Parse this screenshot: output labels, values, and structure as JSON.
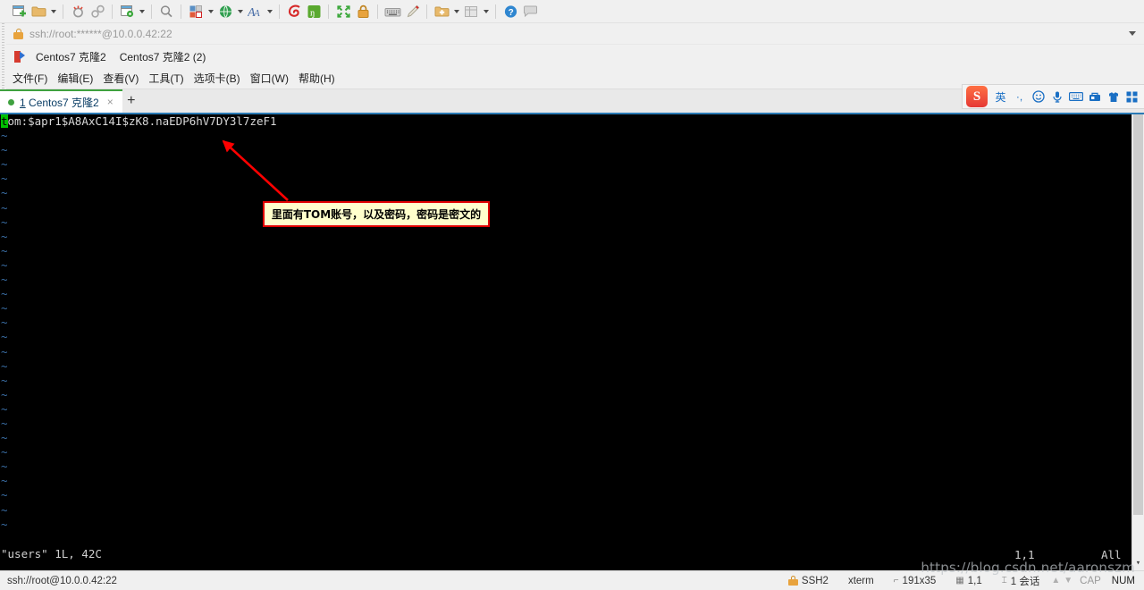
{
  "toolbar": {
    "groups": [
      [
        {
          "name": "new-session-icon",
          "glyph": "new-file"
        },
        {
          "name": "open-folder-icon",
          "glyph": "folder",
          "caret": true
        }
      ],
      [
        {
          "name": "disconnect-icon",
          "glyph": "disconnect"
        },
        {
          "name": "connect-icon",
          "glyph": "link"
        }
      ],
      [
        {
          "name": "session-properties-icon",
          "glyph": "props",
          "caret": true
        }
      ],
      [
        {
          "name": "find-icon",
          "glyph": "search"
        }
      ],
      [
        {
          "name": "layout-icon",
          "glyph": "layout",
          "caret": true
        },
        {
          "name": "global-options-icon",
          "glyph": "globe",
          "caret": true
        },
        {
          "name": "font-icon",
          "glyph": "font",
          "caret": true
        }
      ],
      [
        {
          "name": "log-icon",
          "glyph": "spiral"
        },
        {
          "name": "transfer-icon",
          "glyph": "green-box"
        }
      ],
      [
        {
          "name": "fullscreen-icon",
          "glyph": "expand"
        },
        {
          "name": "lock-icon",
          "glyph": "padlock"
        }
      ],
      [
        {
          "name": "keyboard-icon",
          "glyph": "keyboard"
        },
        {
          "name": "highlight-icon",
          "glyph": "pen"
        }
      ],
      [
        {
          "name": "new-tab-icon",
          "glyph": "add-folder",
          "caret": true
        },
        {
          "name": "split-view-icon",
          "glyph": "split",
          "caret": true
        }
      ],
      [
        {
          "name": "help-icon",
          "glyph": "help"
        },
        {
          "name": "chat-icon",
          "glyph": "chat"
        }
      ]
    ]
  },
  "address_bar": {
    "value": "ssh://root:******@10.0.0.42:22",
    "lock_icon": "lock-icon",
    "dropdown_icon": "chevron-down-icon"
  },
  "bookmarks": {
    "flag_icon": "bookmark-flag-icon",
    "items": [
      {
        "label": "Centos7 克隆2"
      },
      {
        "label": "Centos7 克隆2 (2)"
      }
    ]
  },
  "menubar": {
    "items": [
      {
        "label": "文件(F)"
      },
      {
        "label": "编辑(E)"
      },
      {
        "label": "查看(V)"
      },
      {
        "label": "工具(T)"
      },
      {
        "label": "选项卡(B)"
      },
      {
        "label": "窗口(W)"
      },
      {
        "label": "帮助(H)"
      }
    ]
  },
  "tabs": {
    "active": {
      "index": "1",
      "title": " Centos7 克隆2",
      "close_label": "×",
      "status_dot_color": "#3fa13f"
    },
    "add_label": "+"
  },
  "ime": {
    "logo": "S",
    "buttons": [
      {
        "name": "ime-mode-english",
        "label": "英"
      },
      {
        "name": "ime-punctuation",
        "label": "·,"
      },
      {
        "name": "ime-emoji",
        "label": "☺"
      },
      {
        "name": "ime-voice",
        "label": "🎤"
      },
      {
        "name": "ime-soft-keyboard",
        "label": "⌨"
      },
      {
        "name": "ime-toolbox",
        "label": "🗄"
      },
      {
        "name": "ime-skin",
        "label": "👕"
      },
      {
        "name": "ime-menu",
        "label": "▦"
      }
    ]
  },
  "terminal": {
    "first_line": {
      "cursor_char": "t",
      "rest": "om:$apr1$A8AxC14I$zK8.naEDP6hV7DY3l7zeF1"
    },
    "tilde": "~",
    "tilde_rows": 28,
    "vim_status": {
      "file_info": "\"users\" 1L, 42C",
      "position": "1,1",
      "view": "All"
    },
    "scrollbar": {
      "down_arrow": "▾"
    }
  },
  "annotation": {
    "callout_text": "里面有TOM账号，以及密码，密码是密文的",
    "border_color": "#e00000",
    "fill_color": "#ffffcc",
    "arrow_color": "#ff0000"
  },
  "statusbar": {
    "connection": "ssh://root@10.0.0.42:22",
    "protocol": "SSH2",
    "terminal_type": "xterm",
    "size_icon": "terminal-size-icon",
    "size": "191x35",
    "cursor_icon": "cursor-position-icon",
    "cursor": "1,1",
    "session_icon": "session-count-icon",
    "sessions": "1 会话",
    "arrow_up": "▲",
    "arrow_down": "▼",
    "caps": "CAP",
    "num": "NUM"
  },
  "watermark": {
    "text": "https://blog.csdn.net/aaronszm"
  }
}
